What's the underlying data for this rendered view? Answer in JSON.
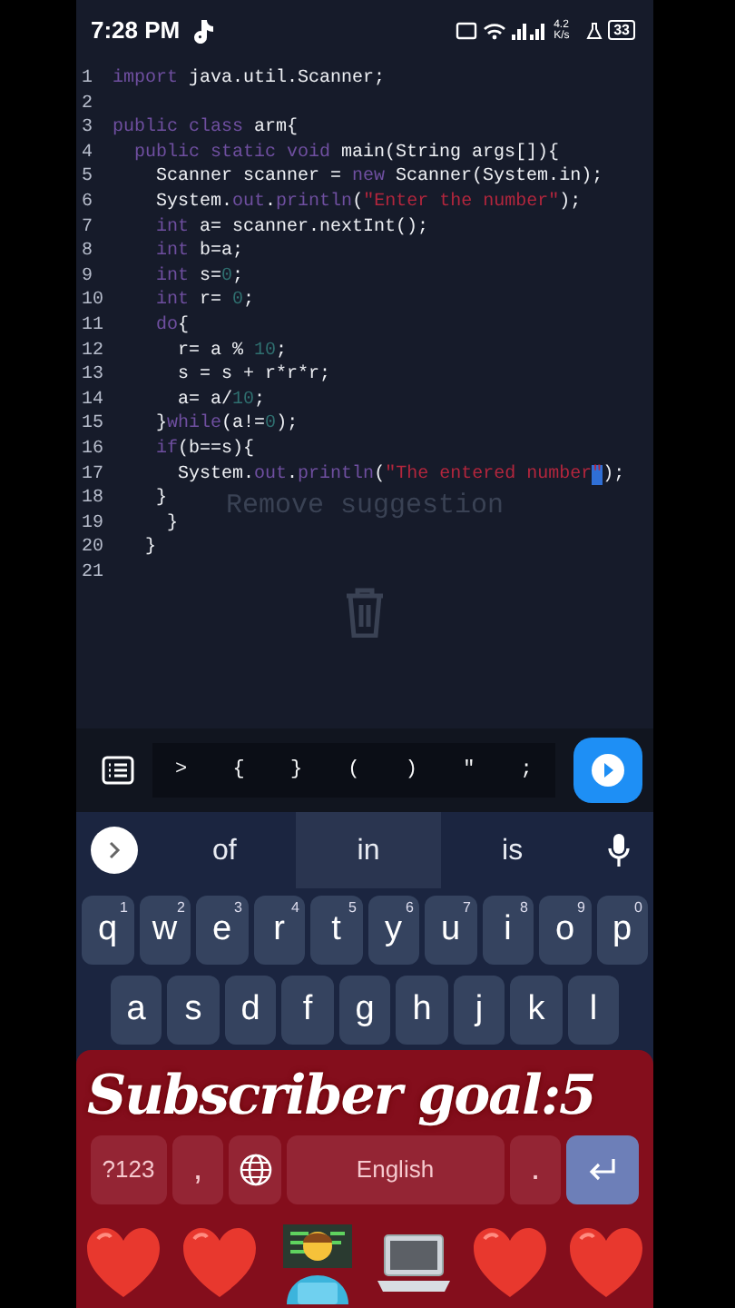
{
  "status_bar": {
    "time": "7:28 PM",
    "net_speed": "4.2 K/s",
    "battery": "33"
  },
  "editor": {
    "lines": [
      {
        "number": "1",
        "tokens": [
          {
            "text": "import",
            "kind": "keyword"
          },
          {
            "text": " java.util.Scanner;",
            "kind": "plain"
          }
        ]
      },
      {
        "number": "2"
      },
      {
        "number": "3",
        "tokens": [
          {
            "text": "public class",
            "kind": "keyword"
          },
          {
            "text": " arm{",
            "kind": "plain"
          }
        ]
      },
      {
        "number": "4",
        "tokens": [
          {
            "text": "  public static void",
            "kind": "keyword"
          },
          {
            "text": " main(String args[]){",
            "kind": "plain"
          }
        ]
      },
      {
        "number": "5",
        "tokens": [
          {
            "text": "    Scanner scanner = ",
            "kind": "plain"
          },
          {
            "text": "new",
            "kind": "keyword"
          },
          {
            "text": " Scanner(System.in);",
            "kind": "plain"
          }
        ]
      },
      {
        "number": "6",
        "tokens": [
          {
            "text": "    System.",
            "kind": "plain"
          },
          {
            "text": "out",
            "kind": "keyword"
          },
          {
            "text": ".",
            "kind": "plain"
          },
          {
            "text": "println",
            "kind": "keyword"
          },
          {
            "text": "(",
            "kind": "plain"
          },
          {
            "text": "\"Enter the number\"",
            "kind": "string"
          },
          {
            "text": ");",
            "kind": "plain"
          }
        ]
      },
      {
        "number": "7",
        "tokens": [
          {
            "text": "    int",
            "kind": "keyword"
          },
          {
            "text": " a= scanner.nextInt();",
            "kind": "plain"
          }
        ]
      },
      {
        "number": "8",
        "tokens": [
          {
            "text": "    int",
            "kind": "keyword"
          },
          {
            "text": " b=a;",
            "kind": "plain"
          }
        ]
      },
      {
        "number": "9",
        "tokens": [
          {
            "text": "    int",
            "kind": "keyword"
          },
          {
            "text": " s=",
            "kind": "plain"
          },
          {
            "text": "0",
            "kind": "number"
          },
          {
            "text": ";",
            "kind": "plain"
          }
        ]
      },
      {
        "number": "10",
        "tokens": [
          {
            "text": "    int",
            "kind": "keyword"
          },
          {
            "text": " r= ",
            "kind": "plain"
          },
          {
            "text": "0",
            "kind": "number"
          },
          {
            "text": ";",
            "kind": "plain"
          }
        ]
      },
      {
        "number": "11",
        "tokens": [
          {
            "text": "    do",
            "kind": "keyword"
          },
          {
            "text": "{",
            "kind": "plain"
          }
        ]
      },
      {
        "number": "12",
        "tokens": [
          {
            "text": "      r= a % ",
            "kind": "plain"
          },
          {
            "text": "10",
            "kind": "number"
          },
          {
            "text": ";",
            "kind": "plain"
          }
        ]
      },
      {
        "number": "13",
        "tokens": [
          {
            "text": "      s = s + r*r*r;",
            "kind": "plain"
          }
        ]
      },
      {
        "number": "14",
        "tokens": [
          {
            "text": "      a= a/",
            "kind": "plain"
          },
          {
            "text": "10",
            "kind": "number"
          },
          {
            "text": ";",
            "kind": "plain"
          }
        ]
      },
      {
        "number": "15",
        "tokens": [
          {
            "text": "    }",
            "kind": "plain"
          },
          {
            "text": "while",
            "kind": "keyword"
          },
          {
            "text": "(a!=",
            "kind": "plain"
          },
          {
            "text": "0",
            "kind": "number"
          },
          {
            "text": ");",
            "kind": "plain"
          }
        ]
      },
      {
        "number": "16",
        "tokens": [
          {
            "text": "    if",
            "kind": "keyword"
          },
          {
            "text": "(b==s){",
            "kind": "plain"
          }
        ]
      },
      {
        "number": "17",
        "tokens": [
          {
            "text": "      System.",
            "kind": "plain",
            "cursor": false
          },
          {
            "text": "out",
            "kind": "keyword",
            "cursor": false
          },
          {
            "text": ".",
            "kind": "plain",
            "cursor": false
          },
          {
            "text": "println",
            "kind": "keyword",
            "cursor": false
          },
          {
            "text": "(",
            "kind": "plain",
            "cursor": false
          },
          {
            "text": "\"The entered number",
            "kind": "string",
            "cursor": false
          },
          {
            "text": "\"",
            "kind": "string",
            "cursor": true
          },
          {
            "text": ");",
            "kind": "plain",
            "cursor": false
          }
        ]
      },
      {
        "number": "18",
        "tokens": [
          {
            "text": "    }",
            "kind": "plain"
          }
        ]
      },
      {
        "number": "19",
        "tokens": [
          {
            "text": "     }",
            "kind": "plain"
          }
        ]
      },
      {
        "number": "20",
        "tokens": [
          {
            "text": "   }",
            "kind": "plain"
          }
        ]
      },
      {
        "number": "21"
      }
    ]
  },
  "drag_target": {
    "label": "Remove suggestion"
  },
  "symbol_bar": {
    "symbols": [
      ">",
      "{",
      "}",
      "(",
      ")",
      "\"",
      ";"
    ]
  },
  "suggestions": [
    {
      "text": "of",
      "selected": false
    },
    {
      "text": "in",
      "selected": true
    },
    {
      "text": "is",
      "selected": false
    }
  ],
  "keyboard": {
    "rows": [
      {
        "keys": [
          {
            "kind": "char",
            "label": "q",
            "hint": "1"
          },
          {
            "kind": "char",
            "label": "w",
            "hint": "2"
          },
          {
            "kind": "char",
            "label": "e",
            "hint": "3"
          },
          {
            "kind": "char",
            "label": "r",
            "hint": "4"
          },
          {
            "kind": "char",
            "label": "t",
            "hint": "5"
          },
          {
            "kind": "char",
            "label": "y",
            "hint": "6"
          },
          {
            "kind": "char",
            "label": "u",
            "hint": "7"
          },
          {
            "kind": "char",
            "label": "i",
            "hint": "8"
          },
          {
            "kind": "char",
            "label": "o",
            "hint": "9"
          },
          {
            "kind": "char",
            "label": "p",
            "hint": "0"
          }
        ]
      },
      {
        "keys": [
          {
            "kind": "char",
            "label": "a"
          },
          {
            "kind": "char",
            "label": "s"
          },
          {
            "kind": "char",
            "label": "d"
          },
          {
            "kind": "char",
            "label": "f"
          },
          {
            "kind": "char",
            "label": "g"
          },
          {
            "kind": "char",
            "label": "h"
          },
          {
            "kind": "char",
            "label": "j"
          },
          {
            "kind": "char",
            "label": "k"
          },
          {
            "kind": "char",
            "label": "l"
          }
        ]
      },
      {
        "keys": [
          {
            "kind": "mode",
            "label": "?123"
          },
          {
            "kind": "char",
            "label": ","
          },
          {
            "kind": "globe"
          },
          {
            "kind": "space",
            "label": "English"
          },
          {
            "kind": "char",
            "label": "."
          },
          {
            "kind": "enter"
          }
        ]
      }
    ]
  },
  "overlay": {
    "title": "Subscriber goal:5"
  }
}
